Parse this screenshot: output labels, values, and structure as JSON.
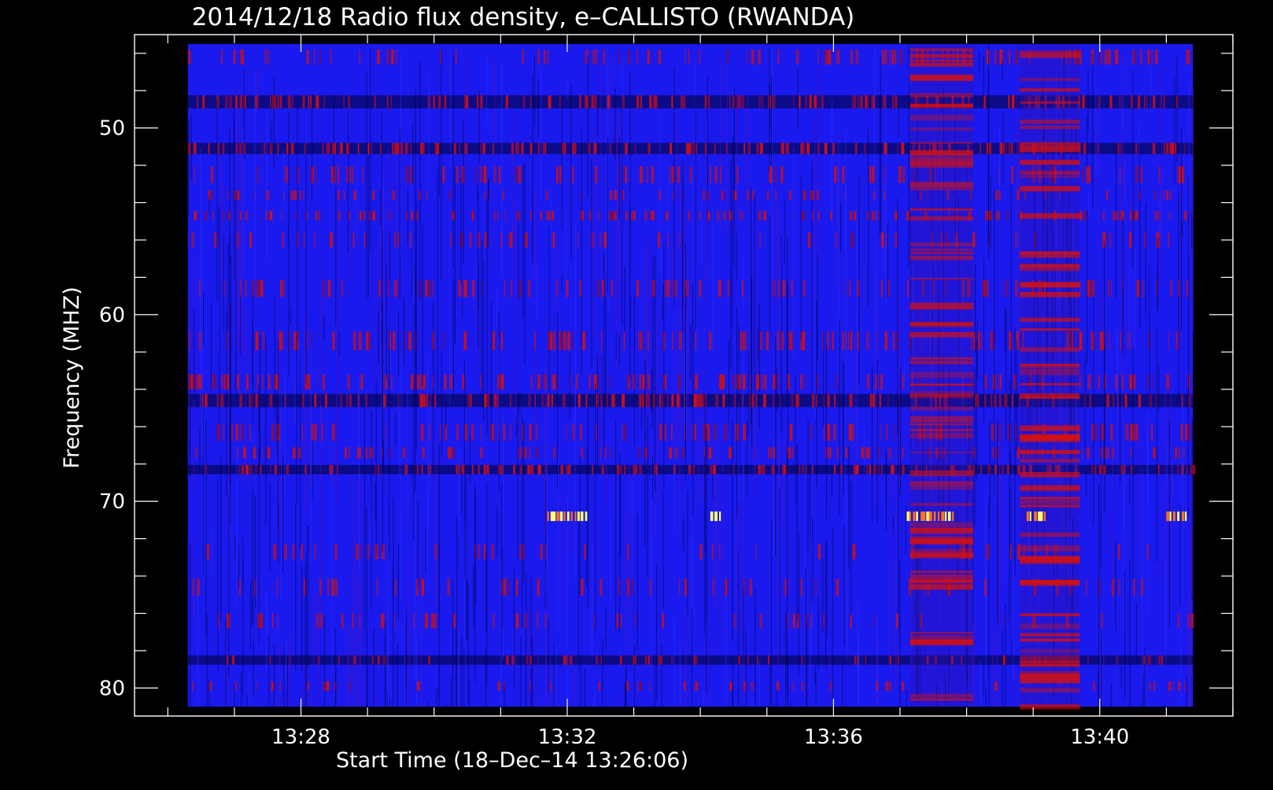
{
  "chart_data": {
    "type": "heatmap",
    "title": "2014/12/18  Radio flux density, e–CALLISTO (RWANDA)",
    "xlabel": "Start Time (18–Dec–14 13:26:06)",
    "ylabel": "Frequency (MHZ)",
    "x_unit": "minutes after 13:00 UT",
    "xlim": [
      25.5,
      42.0
    ],
    "ylim": [
      81.5,
      45.0
    ],
    "y_axis_inverted": true,
    "x_ticks": [
      {
        "value": 28,
        "label": "13:28"
      },
      {
        "value": 32,
        "label": "13:32"
      },
      {
        "value": 36,
        "label": "13:36"
      },
      {
        "value": 40,
        "label": "13:40"
      }
    ],
    "y_ticks": [
      {
        "value": 50,
        "label": "50"
      },
      {
        "value": 60,
        "label": "60"
      },
      {
        "value": 70,
        "label": "70"
      },
      {
        "value": 80,
        "label": "80"
      }
    ],
    "x_minor_step": 1,
    "y_minor_step": 2,
    "data_extent": {
      "x": [
        26.3,
        41.4
      ],
      "y": [
        45.5,
        81.0
      ]
    },
    "colormap": {
      "low": "#0000ff",
      "mid": "#d01000",
      "high": "#ffff60"
    },
    "background_color": "#1a1aee",
    "red_frequency_bands_mhz": [
      {
        "y": 46.2,
        "h": 0.8,
        "s": 0.35
      },
      {
        "y": 48.6,
        "h": 0.7,
        "s": 0.45,
        "dark": true
      },
      {
        "y": 51.1,
        "h": 0.6,
        "s": 0.55,
        "dark": true
      },
      {
        "y": 52.5,
        "h": 0.9,
        "s": 0.25
      },
      {
        "y": 53.6,
        "h": 0.5,
        "s": 0.2
      },
      {
        "y": 54.7,
        "h": 0.5,
        "s": 0.4
      },
      {
        "y": 56.0,
        "h": 0.8,
        "s": 0.15
      },
      {
        "y": 58.6,
        "h": 0.9,
        "s": 0.3
      },
      {
        "y": 61.4,
        "h": 1.0,
        "s": 0.35
      },
      {
        "y": 63.6,
        "h": 0.8,
        "s": 0.4
      },
      {
        "y": 64.6,
        "h": 0.7,
        "s": 0.45,
        "dark": true
      },
      {
        "y": 66.3,
        "h": 0.9,
        "s": 0.3
      },
      {
        "y": 67.4,
        "h": 0.6,
        "s": 0.3
      },
      {
        "y": 68.3,
        "h": 0.5,
        "s": 0.45,
        "dark": true
      },
      {
        "y": 72.7,
        "h": 0.8,
        "s": 0.12
      },
      {
        "y": 74.6,
        "h": 0.9,
        "s": 0.14
      },
      {
        "y": 76.4,
        "h": 0.8,
        "s": 0.12
      },
      {
        "y": 78.5,
        "h": 0.5,
        "s": 0.15,
        "dark": true
      },
      {
        "y": 79.9,
        "h": 0.5,
        "s": 0.1
      }
    ],
    "interference_columns": [
      {
        "x0": 37.15,
        "x1": 38.1
      },
      {
        "x0": 38.8,
        "x1": 39.7
      }
    ],
    "bright_bursts": [
      {
        "freq_mhz": 70.8,
        "segments": [
          [
            31.7,
            32.3
          ],
          [
            34.15,
            34.3
          ],
          [
            37.1,
            37.8
          ],
          [
            38.9,
            39.2
          ],
          [
            41.0,
            41.3
          ]
        ]
      }
    ]
  }
}
